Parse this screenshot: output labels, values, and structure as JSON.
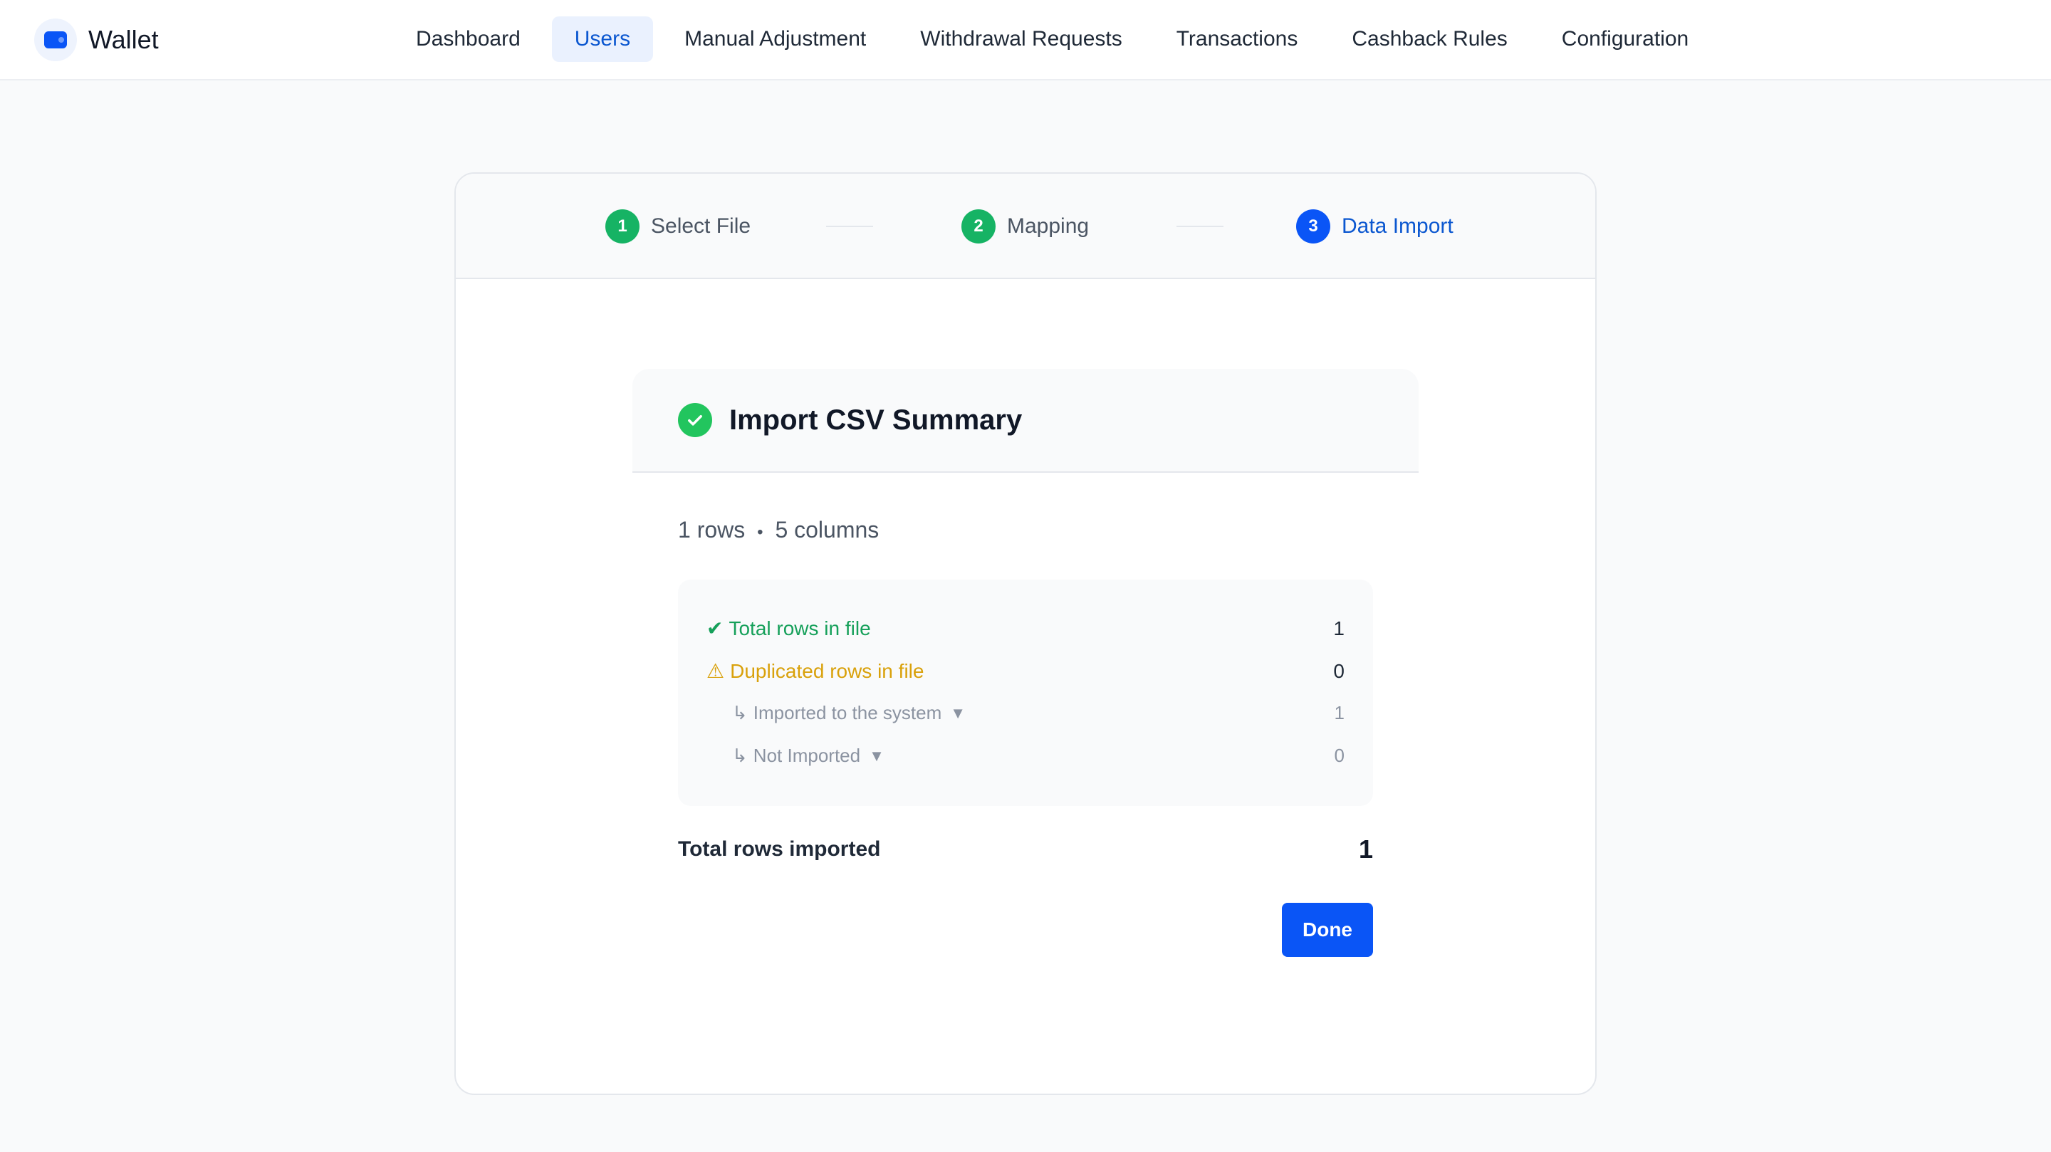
{
  "app": {
    "name": "Wallet",
    "logo_icon": "wallet-icon",
    "accent": "#0a55f6"
  },
  "nav": {
    "items": [
      {
        "label": "Dashboard",
        "active": false
      },
      {
        "label": "Users",
        "active": true
      },
      {
        "label": "Manual Adjustment",
        "active": false
      },
      {
        "label": "Withdrawal Requests",
        "active": false
      },
      {
        "label": "Transactions",
        "active": false
      },
      {
        "label": "Cashback Rules",
        "active": false
      },
      {
        "label": "Configuration",
        "active": false
      }
    ]
  },
  "stepper": {
    "steps": [
      {
        "number": "1",
        "label": "Select File",
        "status": "done"
      },
      {
        "number": "2",
        "label": "Mapping",
        "status": "done"
      },
      {
        "number": "3",
        "label": "Data Import",
        "status": "current"
      }
    ]
  },
  "summary": {
    "title": "Import CSV Summary",
    "status_icon": "check-circle-icon",
    "rows_text": "1 rows",
    "separator": "•",
    "columns_text": "5 columns",
    "stats": {
      "total_rows_label": "Total rows in file",
      "total_rows_icon": "✔",
      "total_rows_value": "1",
      "duplicated_label": "Duplicated rows in file",
      "duplicated_icon": "⚠",
      "duplicated_value": "0",
      "imported_label": "Imported to the system",
      "imported_value": "1",
      "not_imported_label": "Not Imported",
      "not_imported_value": "0",
      "sub_prefix": "↳",
      "caret": "▼"
    },
    "total_imported_label": "Total rows imported",
    "total_imported_value": "1",
    "done_label": "Done"
  }
}
